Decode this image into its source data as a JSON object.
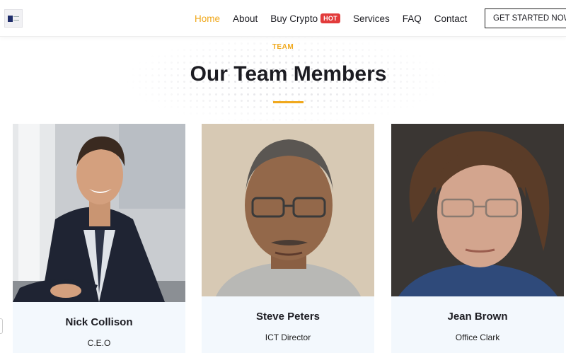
{
  "header": {
    "nav": [
      {
        "label": "Home",
        "active": true
      },
      {
        "label": "About"
      },
      {
        "label": "Buy Crypto",
        "badge": "HOT"
      },
      {
        "label": "Services"
      },
      {
        "label": "FAQ"
      },
      {
        "label": "Contact"
      }
    ],
    "cta_label": "GET STARTED NOW!"
  },
  "section": {
    "eyebrow": "TEAM",
    "title": "Our Team Members"
  },
  "team": [
    {
      "name": "Nick Collison",
      "role": "C.E.O"
    },
    {
      "name": "Steve Peters",
      "role": "ICT Director"
    },
    {
      "name": "Jean Brown",
      "role": "Office Clark"
    }
  ],
  "colors": {
    "accent": "#f0a81c",
    "badge": "#e23b3b",
    "card_bg": "#f3f8fd"
  }
}
